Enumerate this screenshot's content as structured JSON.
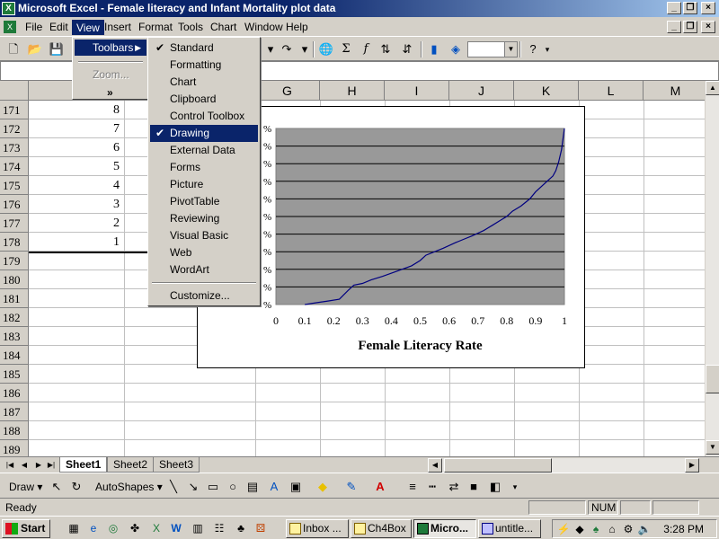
{
  "window": {
    "title": "Microsoft Excel - Female literacy and Infant Mortality plot data"
  },
  "menubar": {
    "items": [
      "File",
      "Edit",
      "View",
      "Insert",
      "Format",
      "Tools",
      "Chart",
      "Window",
      "Help"
    ]
  },
  "view_menu": {
    "items": [
      {
        "label": "Toolbars",
        "state": "highlighted",
        "has_submenu": true
      },
      {
        "label": "Zoom...",
        "state": "disabled"
      },
      {
        "label": "»",
        "state": "expand"
      }
    ]
  },
  "toolbars_submenu": {
    "items": [
      {
        "label": "Standard",
        "checked": true
      },
      {
        "label": "Formatting",
        "checked": false
      },
      {
        "label": "Chart",
        "checked": false
      },
      {
        "label": "Clipboard",
        "checked": false
      },
      {
        "label": "Control Toolbox",
        "checked": false
      },
      {
        "label": "Drawing",
        "checked": true,
        "highlighted": true
      },
      {
        "label": "External Data",
        "checked": false
      },
      {
        "label": "Forms",
        "checked": false
      },
      {
        "label": "Picture",
        "checked": false
      },
      {
        "label": "PivotTable",
        "checked": false
      },
      {
        "label": "Reviewing",
        "checked": false
      },
      {
        "label": "Visual Basic",
        "checked": false
      },
      {
        "label": "Web",
        "checked": false
      },
      {
        "label": "WordArt",
        "checked": false
      },
      {
        "label": "Customize...",
        "checked": false
      }
    ]
  },
  "grid": {
    "columns": [
      "G",
      "H",
      "I",
      "J",
      "K",
      "L",
      "M"
    ],
    "rows": [
      {
        "num": "171",
        "value": "8"
      },
      {
        "num": "172",
        "value": "7"
      },
      {
        "num": "173",
        "value": "6"
      },
      {
        "num": "174",
        "value": "5"
      },
      {
        "num": "175",
        "value": "4"
      },
      {
        "num": "176",
        "value": "3"
      },
      {
        "num": "177",
        "value": "2"
      },
      {
        "num": "178",
        "value": "1"
      },
      {
        "num": "179",
        "value": ""
      },
      {
        "num": "180",
        "value": ""
      },
      {
        "num": "181",
        "value": ""
      },
      {
        "num": "182",
        "value": ""
      },
      {
        "num": "183",
        "value": ""
      },
      {
        "num": "184",
        "value": ""
      },
      {
        "num": "185",
        "value": ""
      },
      {
        "num": "186",
        "value": ""
      },
      {
        "num": "187",
        "value": ""
      },
      {
        "num": "188",
        "value": ""
      },
      {
        "num": "189",
        "value": ""
      }
    ]
  },
  "chart_data": {
    "type": "line",
    "xlabel": "Female Literacy Rate",
    "x_ticks": [
      "0",
      "0.1",
      "0.2",
      "0.3",
      "0.4",
      "0.5",
      "0.6",
      "0.7",
      "0.8",
      "0.9",
      "1"
    ],
    "xlim": [
      0,
      1
    ],
    "ylim": [
      0,
      1
    ],
    "y_gridlines": 10,
    "plot_area_color": "#999999",
    "series": [
      {
        "x": [
          0.1,
          0.14,
          0.18,
          0.22,
          0.25,
          0.27,
          0.3,
          0.33,
          0.37,
          0.42,
          0.47,
          0.5,
          0.52,
          0.55,
          0.58,
          0.62,
          0.65,
          0.68,
          0.72,
          0.75,
          0.78,
          0.8,
          0.82,
          0.85,
          0.88,
          0.9,
          0.92,
          0.94,
          0.96,
          0.97,
          0.98,
          0.99,
          1.0
        ],
        "y": [
          0.0,
          0.01,
          0.02,
          0.03,
          0.08,
          0.11,
          0.12,
          0.14,
          0.16,
          0.19,
          0.22,
          0.25,
          0.28,
          0.3,
          0.32,
          0.35,
          0.37,
          0.39,
          0.42,
          0.45,
          0.48,
          0.5,
          0.53,
          0.56,
          0.6,
          0.64,
          0.67,
          0.7,
          0.73,
          0.76,
          0.81,
          0.88,
          1.0
        ]
      }
    ]
  },
  "sheet_tabs": [
    "Sheet1",
    "Sheet2",
    "Sheet3"
  ],
  "drawbar": {
    "draw_label": "Draw",
    "autoshapes_label": "AutoShapes"
  },
  "status": {
    "text": "Ready",
    "num_indicator": "NUM"
  },
  "taskbar": {
    "start_label": "Start",
    "buttons": [
      "Inbox ...",
      "Ch4Box",
      "Micro...",
      "untitle..."
    ],
    "clock": "3:28 PM"
  }
}
